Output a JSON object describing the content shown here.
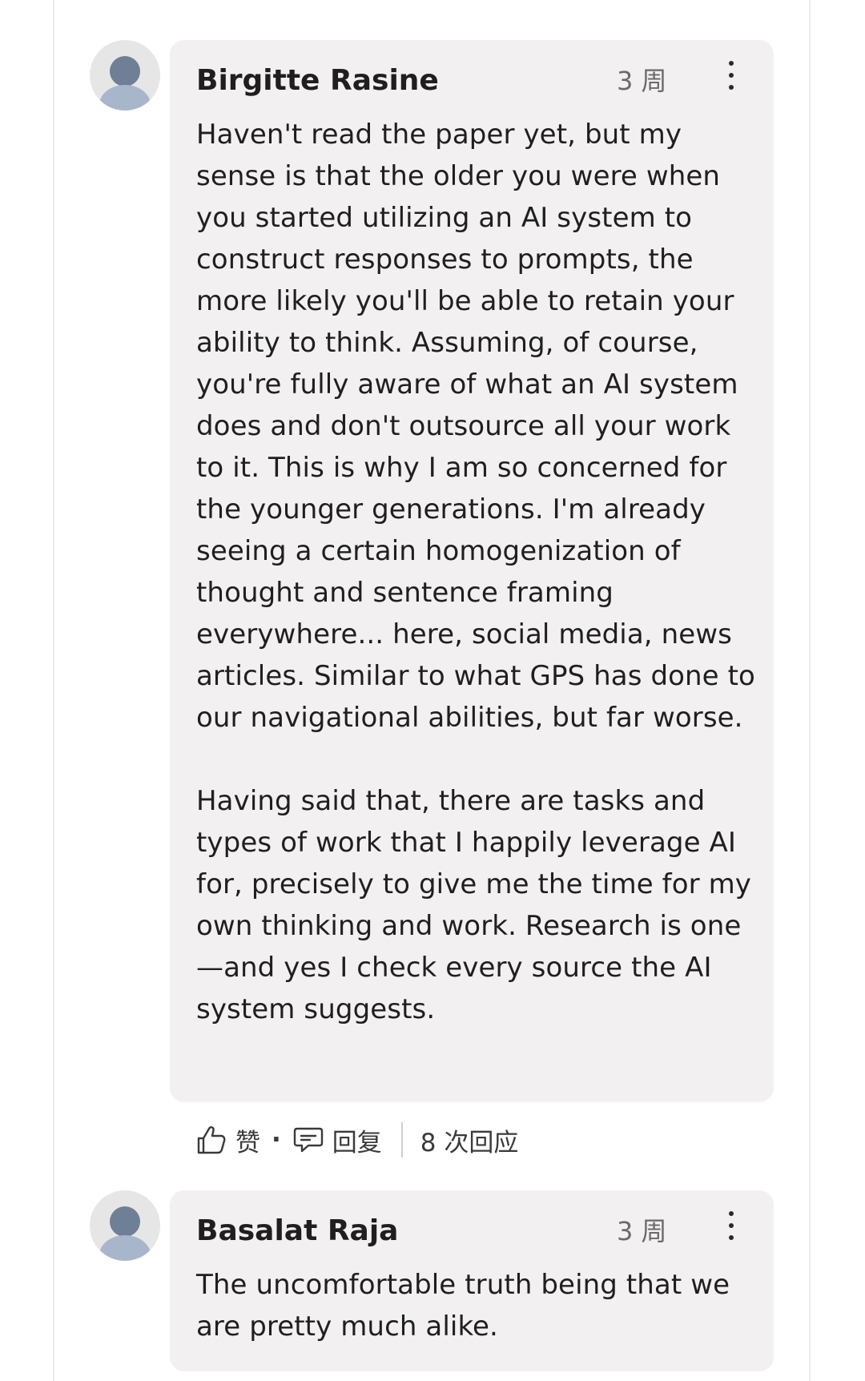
{
  "comments": [
    {
      "author": "Birgitte Rasine",
      "time": "3 周",
      "paragraphs": [
        "Haven't read the paper yet, but my sense is that the older you were when you started utilizing an AI system to construct responses to prompts, the more likely you'll be able to retain your ability to think. Assuming, of course, you're fully aware of what an AI system does and don't outsource all your work to it. This is why I am so concerned for the younger generations. I'm already seeing a certain homogenization of thought and sentence framing everywhere... here, social media, news articles. Similar to what GPS has done to our navigational abilities, but far worse.",
        "Having said that, there are tasks and types of work that I happily leverage AI for, precisely to give me the time for my own thinking and work. Research is one—and yes I check every source the AI system suggests."
      ],
      "actions": {
        "like_label": "赞",
        "separator": "·",
        "reply_label": "回复",
        "responses_label": "8 次回应"
      }
    },
    {
      "author": "Basalat Raja",
      "time": "3 周",
      "paragraphs": [
        "The uncomfortable truth being that we are pretty much alike."
      ]
    }
  ],
  "icons": {
    "like": "thumbs-up-icon",
    "reply": "speech-bubble-icon",
    "more": "more-vertical-icon",
    "avatar": "default-avatar-icon"
  }
}
